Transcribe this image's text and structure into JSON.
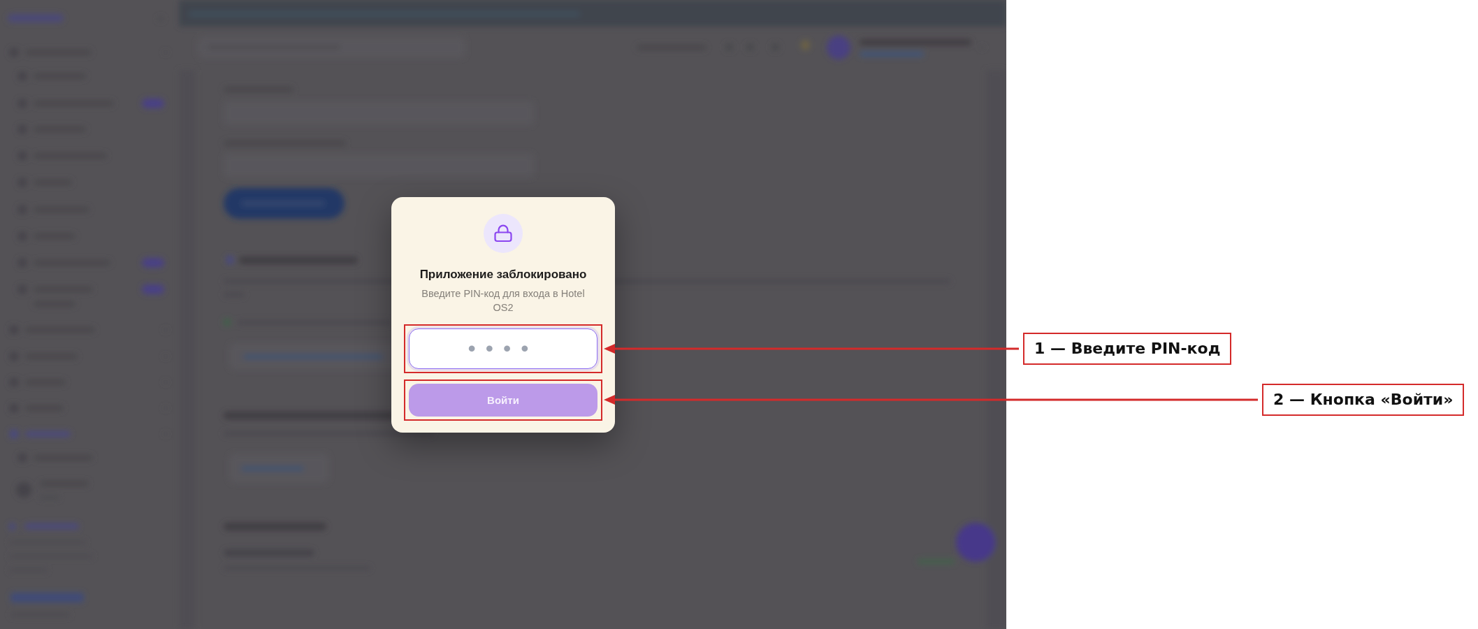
{
  "dialog": {
    "title": "Приложение заблокировано",
    "subtitle": "Введите PIN-код для входа в Hotel OS2",
    "pin_field": {
      "placeholder": "••••",
      "focused": true,
      "annotation": "1 — Введите PIN-код"
    },
    "login_button": {
      "label": "Войти",
      "disabled": true,
      "annotation": "2 — Кнопка «Войти»"
    }
  }
}
